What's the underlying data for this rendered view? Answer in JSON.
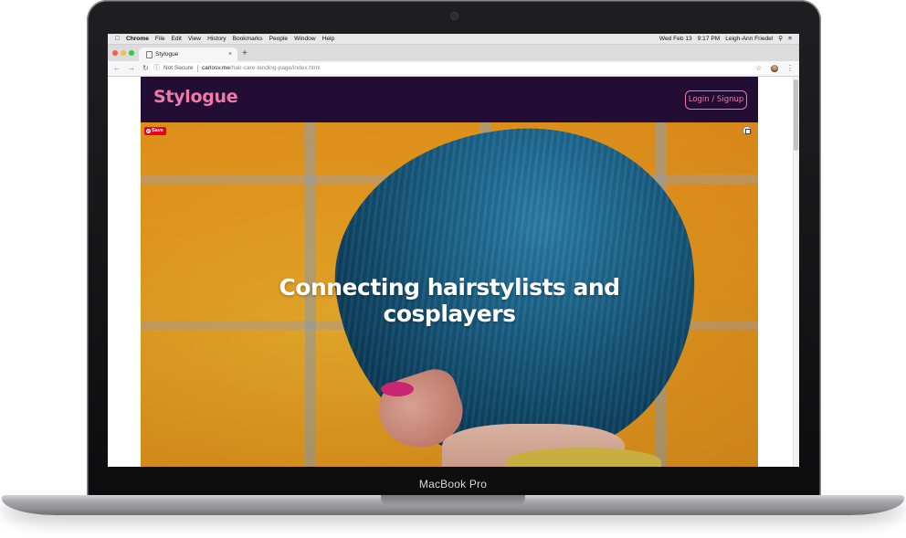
{
  "device": {
    "label": "MacBook Pro"
  },
  "menubar": {
    "apple": "",
    "app_name": "Chrome",
    "menus": [
      "File",
      "Edit",
      "View",
      "History",
      "Bookmarks",
      "People",
      "Window",
      "Help"
    ],
    "date": "Wed Feb 13",
    "time": "9:17 PM",
    "user": "Leigh-Ann Friedel"
  },
  "browser": {
    "tab_title": "Stylogue",
    "tab_close": "×",
    "new_tab": "+",
    "security_label": "Not Secure",
    "url_domain": "carlosv.me",
    "url_path": "/hair-care-landing-page/index.html"
  },
  "site": {
    "logo": "Stylogue",
    "login_button": "Login / Signup",
    "save_badge": "Save",
    "headline": "Connecting hairstylists and cosplayers"
  },
  "colors": {
    "header_bg": "#220d35",
    "brand_pink": "#f07aa7",
    "hero_orange": "#f0a020",
    "hair_blue": "#1c6790"
  }
}
